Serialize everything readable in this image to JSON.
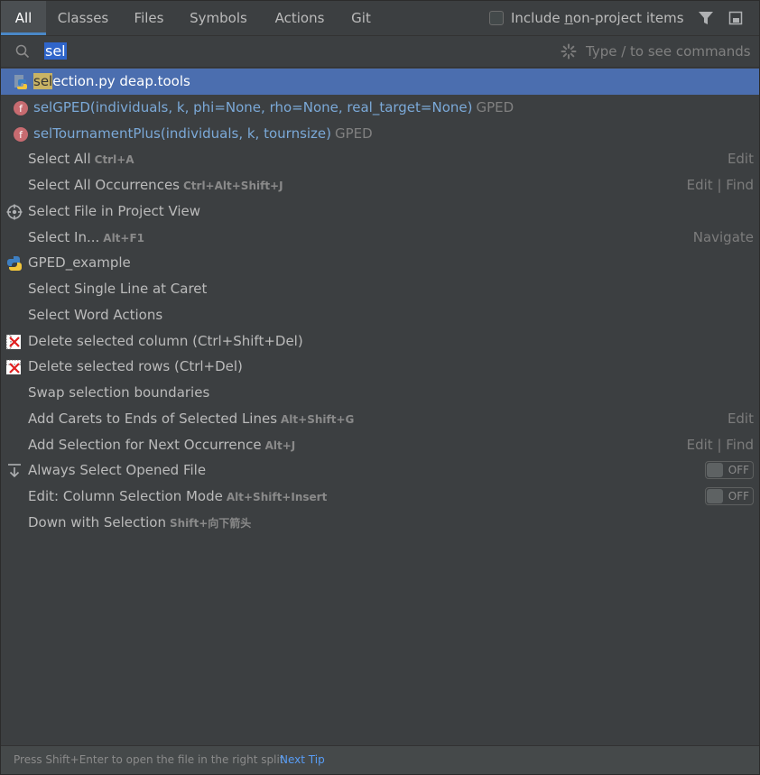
{
  "tabs": [
    {
      "label": "All"
    },
    {
      "label": "Classes"
    },
    {
      "label": "Files"
    },
    {
      "label": "Symbols"
    },
    {
      "label": "Actions"
    },
    {
      "label": "Git"
    }
  ],
  "include": {
    "before": "Include ",
    "underlined": "n",
    "after": "on-project items",
    "checked": false
  },
  "search": {
    "value": "sel",
    "hint": "Type / to see commands"
  },
  "results": [
    {
      "type": "file",
      "hl": "sel",
      "rest": "ection.py",
      "location": "deap.tools",
      "selected": true,
      "icon": "python-file-icon"
    },
    {
      "type": "function",
      "name": "selGPED(individuals, k, phi=None, rho=None, real_target=None)",
      "location": "GPED",
      "icon": "function-icon"
    },
    {
      "type": "function",
      "name": "selTournamentPlus(individuals, k, tournsize)",
      "location": "GPED",
      "icon": "function-icon"
    },
    {
      "type": "action",
      "label": "Select All",
      "shortcut": "Ctrl+A",
      "group": "Edit"
    },
    {
      "type": "action",
      "label": "Select All Occurrences",
      "shortcut": "Ctrl+Alt+Shift+J",
      "group": "Edit | Find"
    },
    {
      "type": "action",
      "label": "Select File in Project View",
      "icon": "locate-icon"
    },
    {
      "type": "action",
      "label": "Select In...",
      "shortcut": "Alt+F1",
      "group": "Navigate"
    },
    {
      "type": "action",
      "label": "GPED_example",
      "icon": "python-icon"
    },
    {
      "type": "action",
      "label": "Select Single Line at Caret"
    },
    {
      "type": "action",
      "label": "Select Word Actions"
    },
    {
      "type": "action",
      "label": "Delete selected column (Ctrl+Shift+Del)",
      "icon": "delete-column-icon"
    },
    {
      "type": "action",
      "label": "Delete selected rows (Ctrl+Del)",
      "icon": "delete-rows-icon"
    },
    {
      "type": "action",
      "label": "Swap selection boundaries"
    },
    {
      "type": "action",
      "label": "Add Carets to Ends of Selected Lines",
      "shortcut": "Alt+Shift+G",
      "group": "Edit"
    },
    {
      "type": "action",
      "label": "Add Selection for Next Occurrence",
      "shortcut": "Alt+J",
      "group": "Edit | Find"
    },
    {
      "type": "toggle",
      "label": "Always Select Opened File",
      "state": "OFF",
      "icon": "autoscroll-icon"
    },
    {
      "type": "toggle",
      "label": "Edit: Column Selection Mode",
      "shortcut": "Alt+Shift+Insert",
      "state": "OFF"
    },
    {
      "type": "action",
      "label": "Down with Selection",
      "shortcut": "Shift+向下箭头"
    }
  ],
  "footer": {
    "text": "Press Shift+Enter to open the file in the right split",
    "link": "Next Tip"
  },
  "colors": {
    "accent": "#4a88c7",
    "selection": "#4b6eaf",
    "background": "#3c3f41",
    "link": "#589df6"
  }
}
